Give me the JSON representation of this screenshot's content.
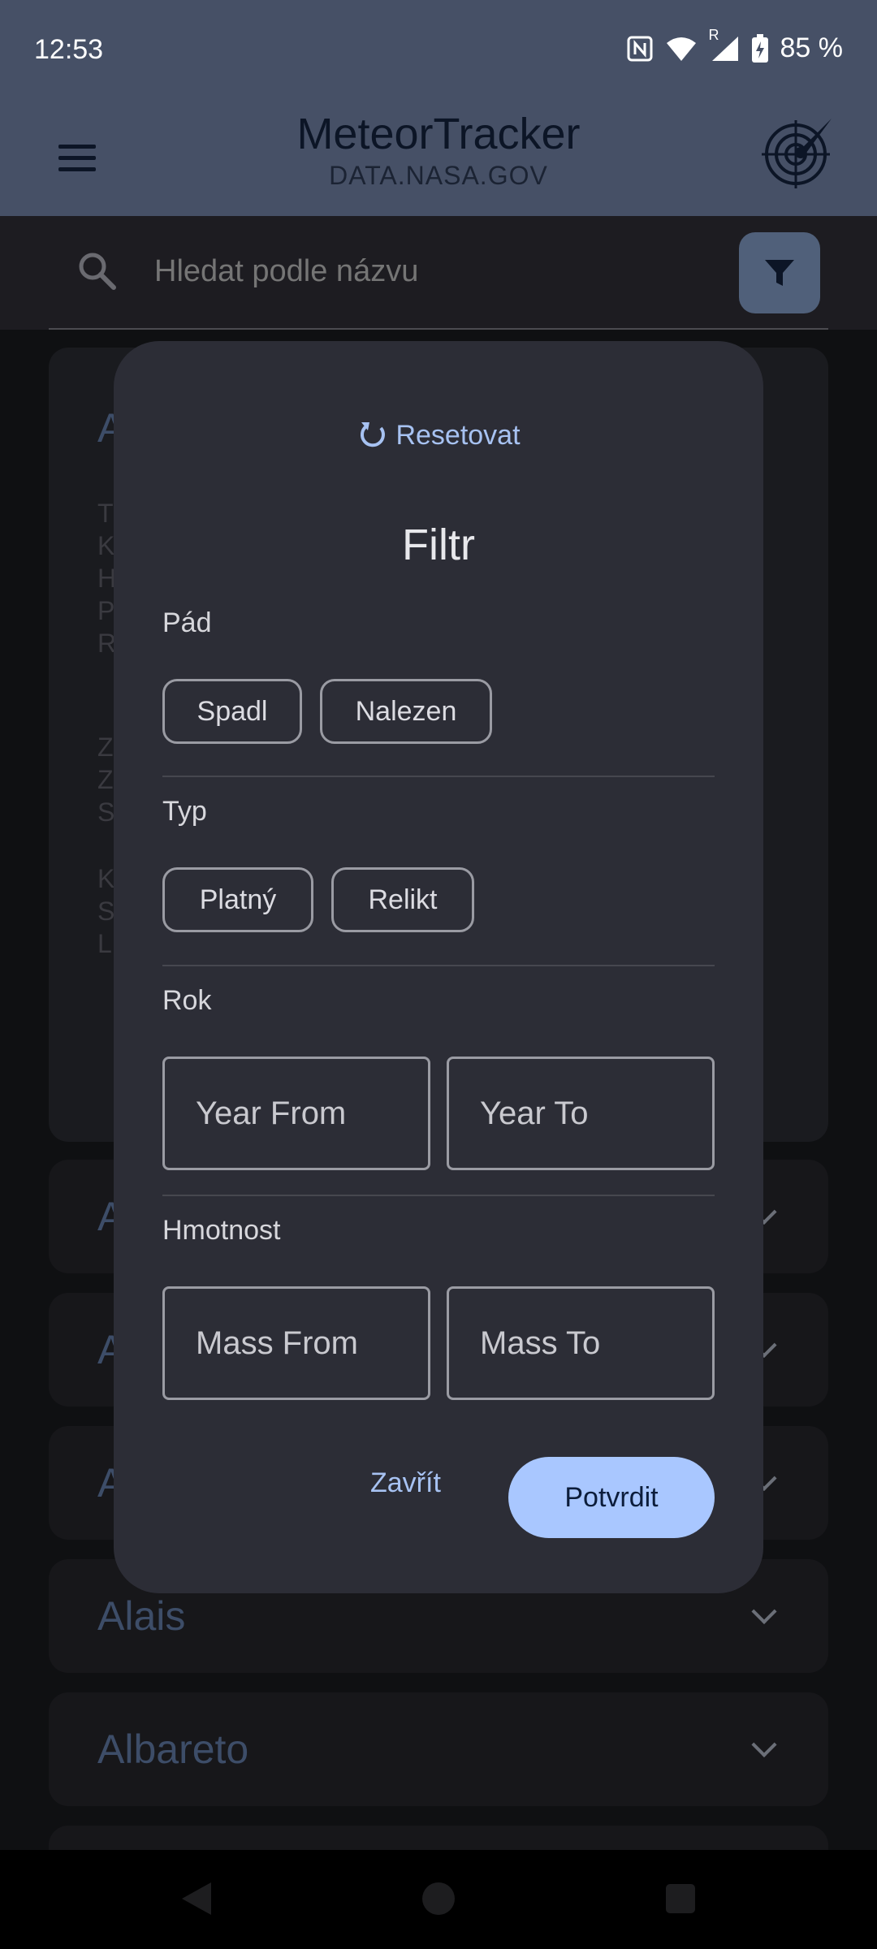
{
  "status_bar": {
    "time": "12:53",
    "battery": "85 %",
    "roaming": "R"
  },
  "app_bar": {
    "title": "MeteorTracker",
    "subtitle": "DATA.NASA.GOV"
  },
  "search": {
    "placeholder": "Hledat podle názvu"
  },
  "list": {
    "peek_letters_top": [
      "T",
      "K",
      "H",
      "P",
      "R"
    ],
    "peek_letters_mid": [
      "Z",
      "Z",
      "S"
    ],
    "peek_letters_bot": [
      "K",
      "S",
      "L"
    ],
    "first_item_initial": "A",
    "collapsed_items": [
      {
        "label": "A"
      },
      {
        "label": "A"
      },
      {
        "label": "A"
      },
      {
        "label": "Alais"
      },
      {
        "label": "Albareto"
      }
    ]
  },
  "dialog": {
    "reset_label": "Resetovat",
    "title": "Filtr",
    "fall": {
      "label": "Pád",
      "options": [
        "Spadl",
        "Nalezen"
      ]
    },
    "type": {
      "label": "Typ",
      "options": [
        "Platný",
        "Relikt"
      ]
    },
    "year": {
      "label": "Rok",
      "from_placeholder": "Year From",
      "to_placeholder": "Year To"
    },
    "mass": {
      "label": "Hmotnost",
      "from_placeholder": "Mass From",
      "to_placeholder": "Mass To"
    },
    "close_label": "Zavřít",
    "confirm_label": "Potvrdit"
  },
  "colors": {
    "app_bar": "#465066",
    "dialog_bg": "#2c2d36",
    "accent": "#a9c7ff",
    "accent_text": "#a7c2f2"
  }
}
